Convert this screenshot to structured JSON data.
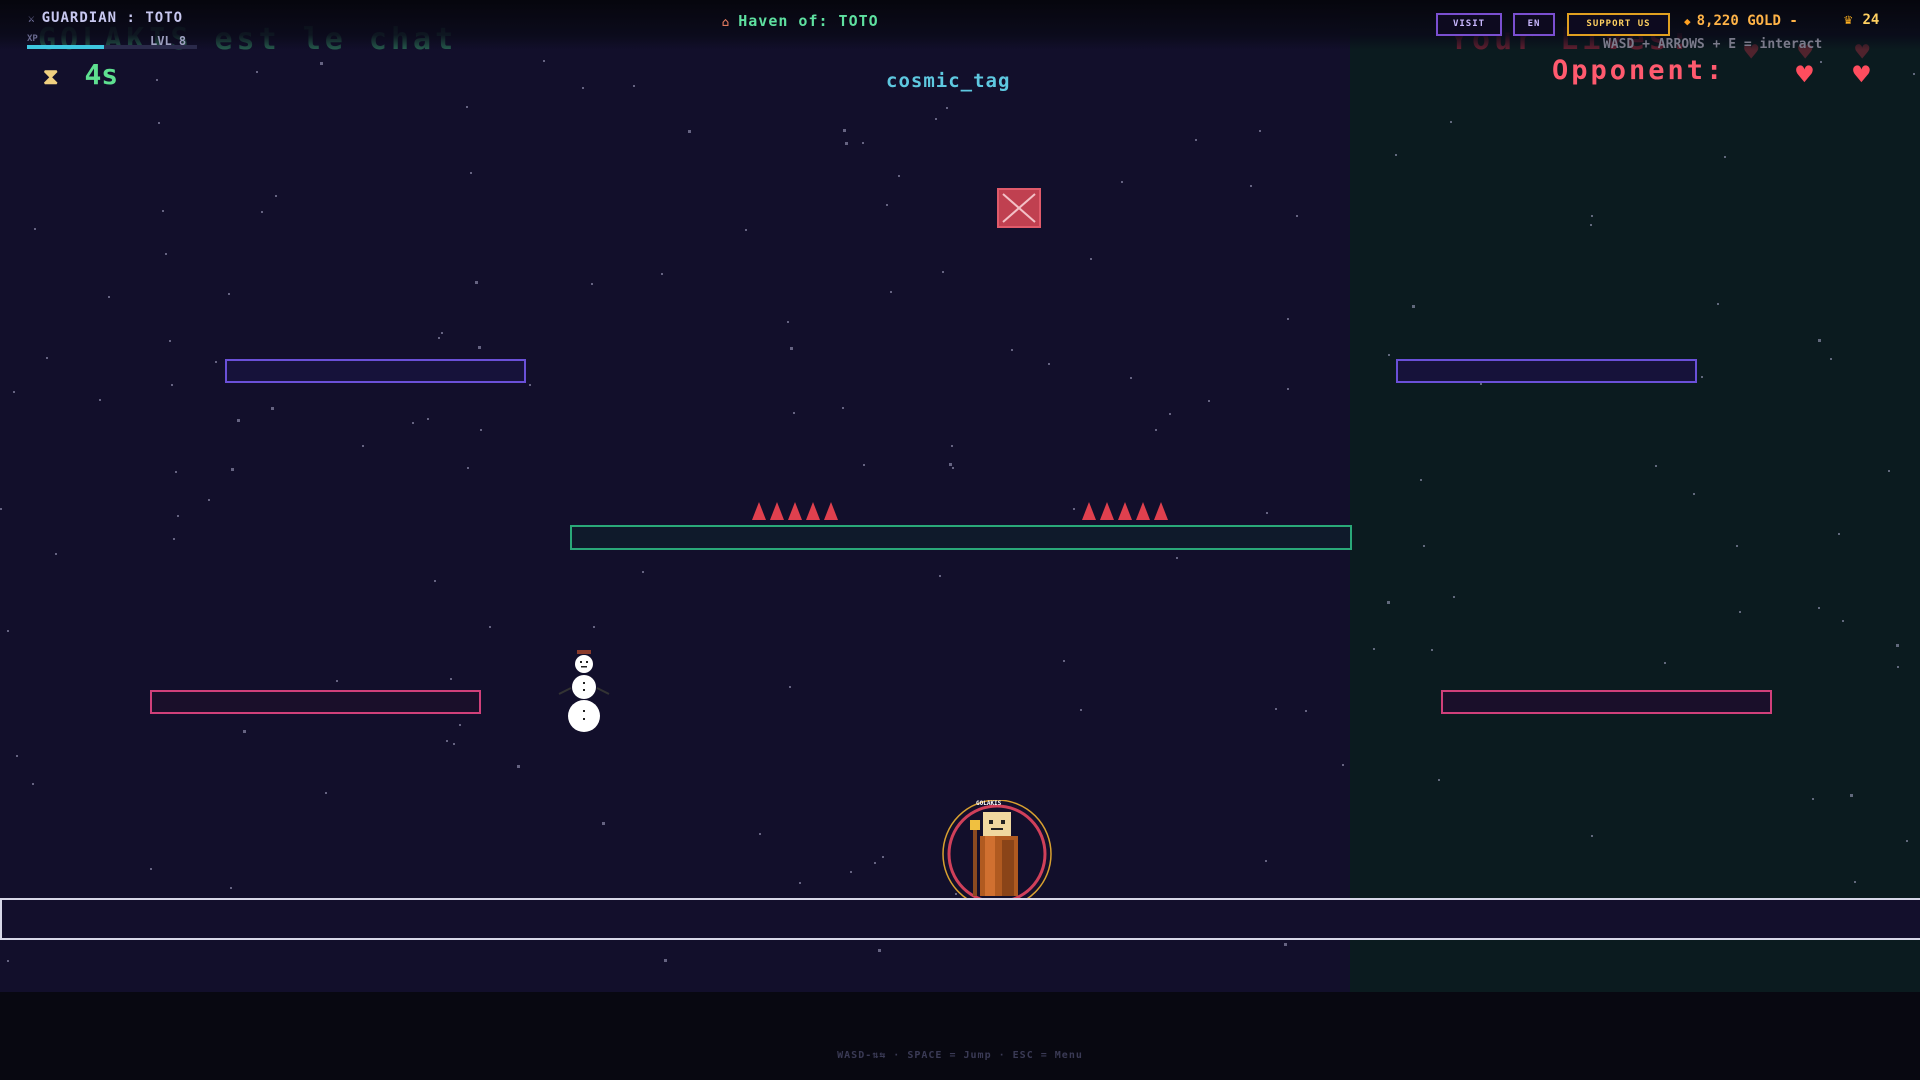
{
  "header": {
    "player_name": "GUARDIAN : TOTO",
    "xp_label": "XP",
    "xp_progress": 0.45,
    "level": "LVL 8",
    "haven": "Haven of: TOTO",
    "visit_label": "VISIT",
    "lang_label": "EN",
    "support_label": "SUPPORT US",
    "gold": "8,220 GOLD -",
    "crowns": "24"
  },
  "hud": {
    "banner_text": "GOLAKIS est le chat",
    "lives_text": "Your Lives:",
    "controls_hint": "WASD + ARROWS + E = interact",
    "timer": "4s",
    "opponent_label": "Opponent:",
    "opponent_hearts": 2,
    "player_hearts": 3
  },
  "game": {
    "title": "cosmic_tag",
    "player_tag": "GOLAKIS"
  },
  "footer": {
    "hint": "WASD-⇅⇆ · SPACE = Jump · ESC = Menu"
  },
  "icons": {
    "sword": "sword-icon",
    "house": "house-icon",
    "coin": "coin-icon",
    "crown": "crown-icon",
    "hourglass": "hourglass-icon",
    "heart": "heart-icon"
  },
  "colors": {
    "background": "#120f2b",
    "right_zone": "#0b1b1f",
    "accent_green": "#5ee090",
    "accent_red": "#ff4d5e",
    "gold": "#ffb347"
  }
}
